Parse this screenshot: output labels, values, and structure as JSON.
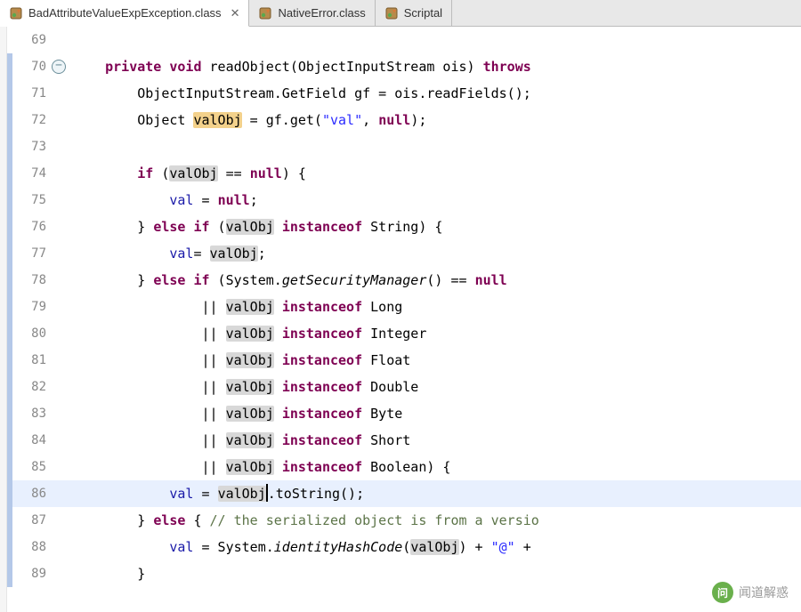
{
  "tabs": [
    {
      "label": "BadAttributeValueExpException.class",
      "active": true
    },
    {
      "label": "NativeError.class",
      "active": false
    },
    {
      "label": "Scriptal",
      "active": false
    }
  ],
  "close_glyph": "✕",
  "fold_glyph": "−",
  "current_line": 86,
  "highlight_token": "valObj",
  "lines": [
    {
      "n": 69,
      "ann": false,
      "tokens": []
    },
    {
      "n": 70,
      "ann": true,
      "fold": true,
      "tokens": [
        {
          "t": "    "
        },
        {
          "t": "private",
          "c": "kw"
        },
        {
          "t": " "
        },
        {
          "t": "void",
          "c": "kw"
        },
        {
          "t": " readObject(ObjectInputStream ois) "
        },
        {
          "t": "throws",
          "c": "kw"
        }
      ]
    },
    {
      "n": 71,
      "ann": true,
      "tokens": [
        {
          "t": "        ObjectInputStream.GetField gf = ois.readFields();"
        }
      ]
    },
    {
      "n": 72,
      "ann": true,
      "tokens": [
        {
          "t": "        Object "
        },
        {
          "t": "valObj",
          "c": "hl-decl"
        },
        {
          "t": " = gf.get("
        },
        {
          "t": "\"val\"",
          "c": "str"
        },
        {
          "t": ", "
        },
        {
          "t": "null",
          "c": "nul"
        },
        {
          "t": ");"
        }
      ]
    },
    {
      "n": 73,
      "ann": true,
      "tokens": []
    },
    {
      "n": 74,
      "ann": true,
      "tokens": [
        {
          "t": "        "
        },
        {
          "t": "if",
          "c": "kw"
        },
        {
          "t": " ("
        },
        {
          "t": "valObj",
          "c": "hl"
        },
        {
          "t": " == "
        },
        {
          "t": "null",
          "c": "nul"
        },
        {
          "t": ") {"
        }
      ]
    },
    {
      "n": 75,
      "ann": true,
      "tokens": [
        {
          "t": "            "
        },
        {
          "t": "val",
          "c": "field"
        },
        {
          "t": " = "
        },
        {
          "t": "null",
          "c": "nul"
        },
        {
          "t": ";"
        }
      ]
    },
    {
      "n": 76,
      "ann": true,
      "tokens": [
        {
          "t": "        } "
        },
        {
          "t": "else",
          "c": "kw"
        },
        {
          "t": " "
        },
        {
          "t": "if",
          "c": "kw"
        },
        {
          "t": " ("
        },
        {
          "t": "valObj",
          "c": "hl"
        },
        {
          "t": " "
        },
        {
          "t": "instanceof",
          "c": "kw"
        },
        {
          "t": " String) {"
        }
      ]
    },
    {
      "n": 77,
      "ann": true,
      "tokens": [
        {
          "t": "            "
        },
        {
          "t": "val",
          "c": "field"
        },
        {
          "t": "= "
        },
        {
          "t": "valObj",
          "c": "hl"
        },
        {
          "t": ";"
        }
      ]
    },
    {
      "n": 78,
      "ann": true,
      "tokens": [
        {
          "t": "        } "
        },
        {
          "t": "else",
          "c": "kw"
        },
        {
          "t": " "
        },
        {
          "t": "if",
          "c": "kw"
        },
        {
          "t": " (System."
        },
        {
          "t": "getSecurityManager",
          "c": "mname"
        },
        {
          "t": "() == "
        },
        {
          "t": "null",
          "c": "nul"
        }
      ]
    },
    {
      "n": 79,
      "ann": true,
      "tokens": [
        {
          "t": "                || "
        },
        {
          "t": "valObj",
          "c": "hl"
        },
        {
          "t": " "
        },
        {
          "t": "instanceof",
          "c": "kw"
        },
        {
          "t": " Long"
        }
      ]
    },
    {
      "n": 80,
      "ann": true,
      "tokens": [
        {
          "t": "                || "
        },
        {
          "t": "valObj",
          "c": "hl"
        },
        {
          "t": " "
        },
        {
          "t": "instanceof",
          "c": "kw"
        },
        {
          "t": " Integer"
        }
      ]
    },
    {
      "n": 81,
      "ann": true,
      "tokens": [
        {
          "t": "                || "
        },
        {
          "t": "valObj",
          "c": "hl"
        },
        {
          "t": " "
        },
        {
          "t": "instanceof",
          "c": "kw"
        },
        {
          "t": " Float"
        }
      ]
    },
    {
      "n": 82,
      "ann": true,
      "tokens": [
        {
          "t": "                || "
        },
        {
          "t": "valObj",
          "c": "hl"
        },
        {
          "t": " "
        },
        {
          "t": "instanceof",
          "c": "kw"
        },
        {
          "t": " Double"
        }
      ]
    },
    {
      "n": 83,
      "ann": true,
      "tokens": [
        {
          "t": "                || "
        },
        {
          "t": "valObj",
          "c": "hl"
        },
        {
          "t": " "
        },
        {
          "t": "instanceof",
          "c": "kw"
        },
        {
          "t": " Byte"
        }
      ]
    },
    {
      "n": 84,
      "ann": true,
      "tokens": [
        {
          "t": "                || "
        },
        {
          "t": "valObj",
          "c": "hl"
        },
        {
          "t": " "
        },
        {
          "t": "instanceof",
          "c": "kw"
        },
        {
          "t": " Short"
        }
      ]
    },
    {
      "n": 85,
      "ann": true,
      "tokens": [
        {
          "t": "                || "
        },
        {
          "t": "valObj",
          "c": "hl"
        },
        {
          "t": " "
        },
        {
          "t": "instanceof",
          "c": "kw"
        },
        {
          "t": " Boolean) {"
        }
      ]
    },
    {
      "n": 86,
      "ann": true,
      "tokens": [
        {
          "t": "            "
        },
        {
          "t": "val",
          "c": "field"
        },
        {
          "t": " = "
        },
        {
          "t": "valObj",
          "c": "hl"
        },
        {
          "caret": true
        },
        {
          "t": ".toString();"
        }
      ]
    },
    {
      "n": 87,
      "ann": true,
      "tokens": [
        {
          "t": "        } "
        },
        {
          "t": "else",
          "c": "kw"
        },
        {
          "t": " { "
        },
        {
          "t": "// the serialized object is from a versio",
          "c": "cmt"
        }
      ]
    },
    {
      "n": 88,
      "ann": true,
      "tokens": [
        {
          "t": "            "
        },
        {
          "t": "val",
          "c": "field"
        },
        {
          "t": " = System."
        },
        {
          "t": "identityHashCode",
          "c": "mname"
        },
        {
          "t": "("
        },
        {
          "t": "valObj",
          "c": "hl"
        },
        {
          "t": ") + "
        },
        {
          "t": "\"@\"",
          "c": "str"
        },
        {
          "t": " +"
        }
      ]
    },
    {
      "n": 89,
      "ann": true,
      "tokens": [
        {
          "t": "        }"
        }
      ]
    }
  ],
  "watermark": {
    "text": "闻道解惑"
  }
}
